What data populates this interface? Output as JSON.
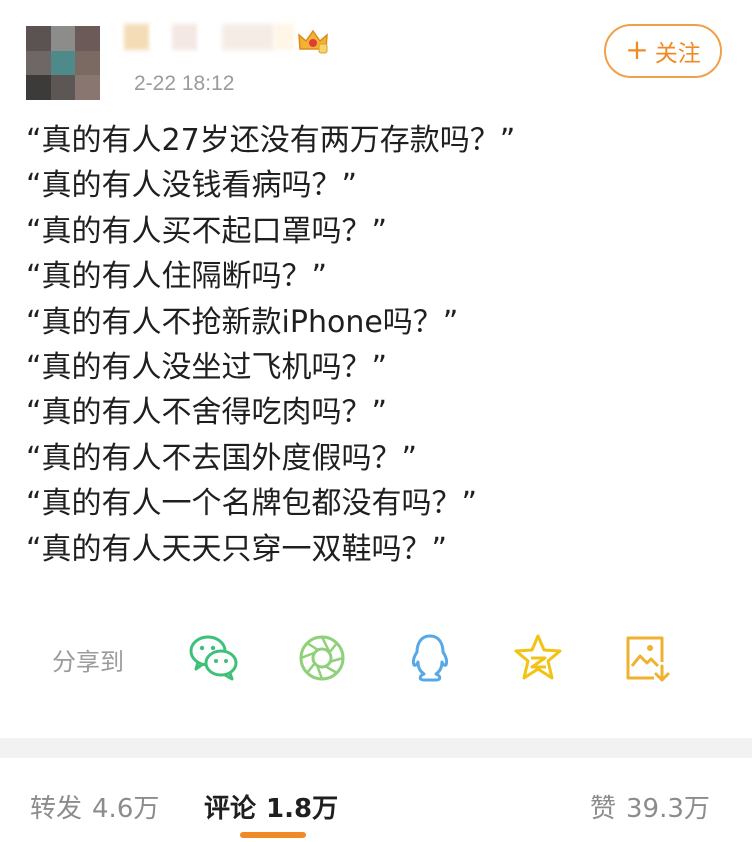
{
  "post": {
    "timestamp": "2-22 18:12",
    "follow_label": "关注",
    "lines": [
      "“真的有人27岁还没有两万存款吗？”",
      "“真的有人没钱看病吗？”",
      "“真的有人买不起口罩吗？”",
      "“真的有人住隔断吗？”",
      "“真的有人不抢新款iPhone吗？”",
      "“真的有人没坐过飞机吗？”",
      "“真的有人不舍得吃肉吗？”",
      "“真的有人不去国外度假吗？”",
      "“真的有人一个名牌包都没有吗？”",
      "“真的有人天天只穿一双鞋吗？”"
    ]
  },
  "share": {
    "label": "分享到",
    "icons": [
      "wechat-icon",
      "moments-icon",
      "qq-icon",
      "qzone-icon",
      "save-image-icon"
    ]
  },
  "stats": {
    "repost_label": "转发",
    "repost_count": "4.6万",
    "comment_label": "评论",
    "comment_count": "1.8万",
    "like_label": "赞",
    "like_count": "39.3万"
  },
  "colors": {
    "accent": "#f08a24",
    "wechat": "#3ec07a",
    "moments": "#8fd17a",
    "qq": "#57a8e6",
    "qzone": "#f2c314",
    "save": "#f0b030"
  }
}
